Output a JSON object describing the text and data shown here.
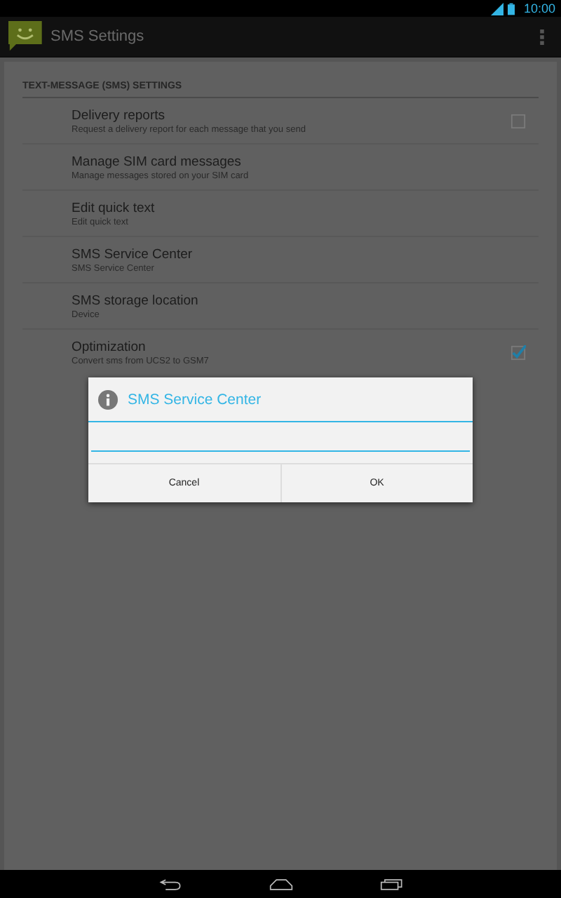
{
  "status_bar": {
    "time": "10:00"
  },
  "action_bar": {
    "title": "SMS Settings"
  },
  "section": {
    "title": "TEXT-MESSAGE (SMS) SETTINGS"
  },
  "settings": [
    {
      "title": "Delivery reports",
      "summary": "Request a delivery report for each message that you send",
      "kind": "checkbox",
      "checked": false
    },
    {
      "title": "Manage SIM card messages",
      "summary": "Manage messages stored on your SIM card",
      "kind": "plain"
    },
    {
      "title": "Edit quick text",
      "summary": "Edit quick text",
      "kind": "plain"
    },
    {
      "title": "SMS Service Center",
      "summary": "SMS Service Center",
      "kind": "plain"
    },
    {
      "title": "SMS storage location",
      "summary": "Device",
      "kind": "plain"
    },
    {
      "title": "Optimization",
      "summary": "Convert sms from UCS2 to GSM7",
      "kind": "checkbox",
      "checked": true
    }
  ],
  "dialog": {
    "title": "SMS Service Center",
    "buttons": [
      "Cancel",
      "OK"
    ]
  }
}
